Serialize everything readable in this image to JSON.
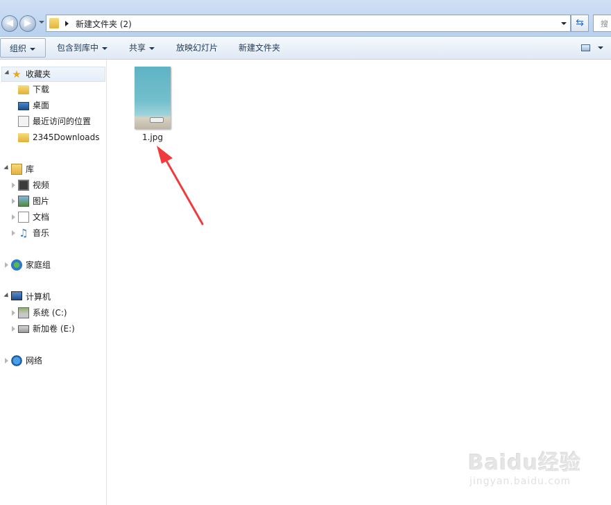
{
  "address_bar": {
    "path": "新建文件夹 (2)",
    "search_placeholder": "搜"
  },
  "toolbar": {
    "organize": "组织",
    "include_in_library": "包含到库中",
    "share": "共享",
    "slideshow": "放映幻灯片",
    "new_folder": "新建文件夹"
  },
  "sidebar": {
    "favorites": {
      "label": "收藏夹",
      "items": [
        "下载",
        "桌面",
        "最近访问的位置",
        "2345Downloads"
      ]
    },
    "libraries": {
      "label": "库",
      "items": [
        "视频",
        "图片",
        "文档",
        "音乐"
      ]
    },
    "homegroup": {
      "label": "家庭组"
    },
    "computer": {
      "label": "计算机",
      "items": [
        "系统 (C:)",
        "新加卷 (E:)"
      ]
    },
    "network": {
      "label": "网络"
    }
  },
  "files": [
    {
      "name": "1.jpg"
    }
  ],
  "watermark": {
    "brand": "Baidu经验",
    "url": "jingyan.baidu.com"
  },
  "colors": {
    "annotation_arrow": "#ef3b3b",
    "selected_nav": "#e4edf8"
  }
}
